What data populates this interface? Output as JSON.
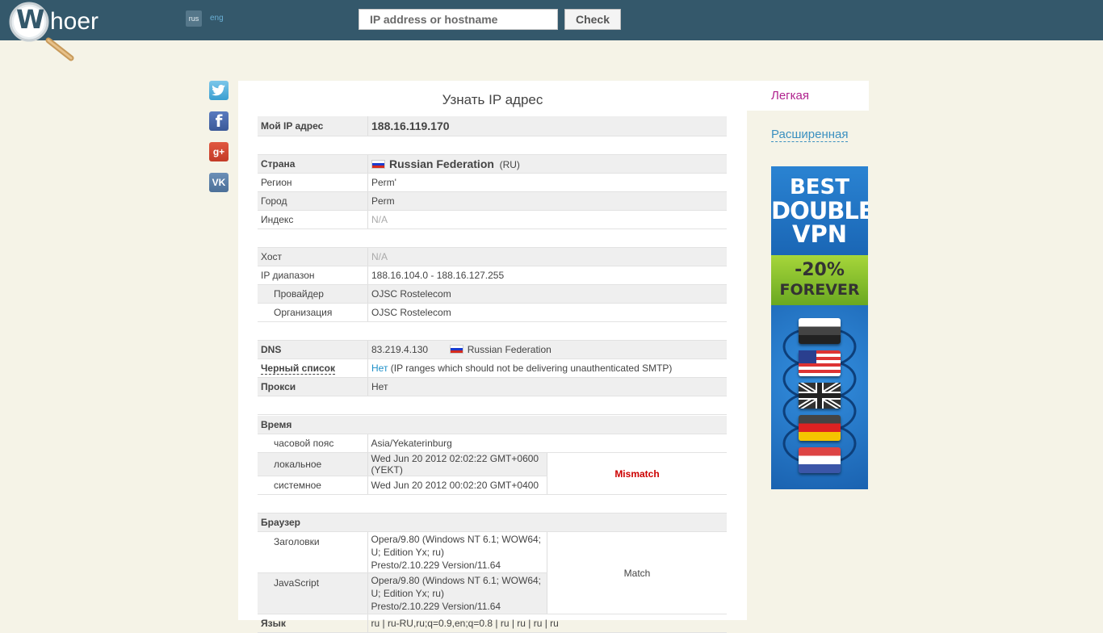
{
  "header": {
    "logo_letter": "W",
    "logo_text": "hoer",
    "lang_rus": "rus",
    "lang_eng": "eng",
    "search_placeholder": "IP address or hostname",
    "check_label": "Check"
  },
  "social": [
    "twitter",
    "facebook",
    "google-plus",
    "vk"
  ],
  "social_labels": {
    "facebook": "f",
    "google_plus": "g+",
    "vk": "VK"
  },
  "main": {
    "title": "Узнать IP адрес",
    "my_ip_label": "Мой IP адрес",
    "my_ip": "188.16.119.170",
    "country_label": "Страна",
    "country": "Russian Federation",
    "country_code": "(RU)",
    "region_label": "Регион",
    "region": "Perm'",
    "city_label": "Город",
    "city": "Perm",
    "index_label": "Индекс",
    "index": "N/A",
    "host_label": "Хост",
    "host": "N/A",
    "range_label": "IP диапазон",
    "range": "188.16.104.0 - 188.16.127.255",
    "provider_label": "Провайдер",
    "provider": "OJSC Rostelecom",
    "org_label": "Организация",
    "org": "OJSC Rostelecom",
    "dns_label": "DNS",
    "dns_ip": "83.219.4.130",
    "dns_country": "Russian Federation",
    "blacklist_label": "Черный список",
    "blacklist_value": "Нет",
    "blacklist_note": "(IP ranges which should not be delivering unauthenticated SMTP)",
    "proxy_label": "Прокси",
    "proxy": "Нет",
    "time_label": "Время",
    "tz_label": "часовой пояс",
    "tz": "Asia/Yekaterinburg",
    "local_label": "локальное",
    "local": "Wed Jun 20 2012 02:02:22 GMT+0600 (YEKT)",
    "system_label": "системное",
    "system": "Wed Jun 20 2012 00:02:20 GMT+0400",
    "time_status": "Mismatch",
    "browser_label": "Браузер",
    "headers_label": "Заголовки",
    "headers_line1": "Opera/9.80 (Windows NT 6.1; WOW64; U; Edition Yx; ru)",
    "headers_line2": "Presto/2.10.229 Version/11.64",
    "js_label": "JavaScript",
    "js_line1": "Opera/9.80 (Windows NT 6.1; WOW64; U; Edition Yx; ru)",
    "js_line2": "Presto/2.10.229 Version/11.64",
    "browser_status": "Match",
    "lang_label": "Язык",
    "lang": "ru | ru-RU,ru;q=0.9,en;q=0.8 | ru | ru | ru | ru"
  },
  "side": {
    "tab_light": "Легкая",
    "tab_ext": "Расширенная"
  },
  "ad": {
    "line1": "BEST",
    "line2": "DOUBLE",
    "line3": "VPN",
    "discount": "-20%",
    "forever": "FOREVER"
  },
  "colors": {
    "header_bg": "#34586b",
    "page_bg": "#f5f3e7",
    "mismatch": "#cc0000",
    "tab_light": "#b0238e",
    "link": "#1e90c8"
  }
}
